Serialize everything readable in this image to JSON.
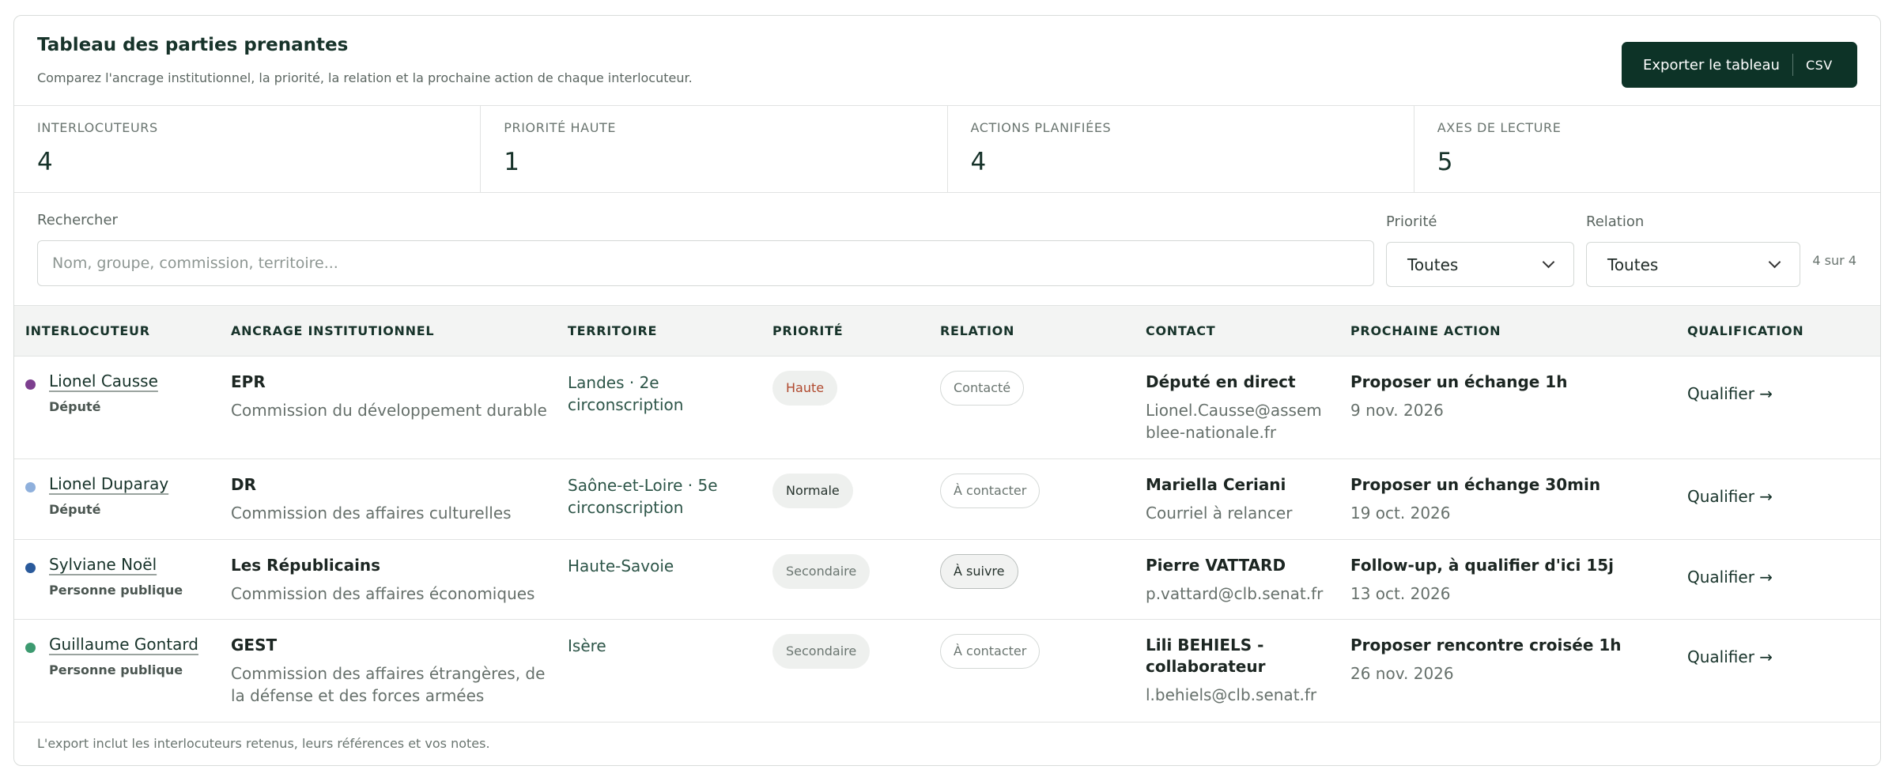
{
  "header": {
    "title": "Tableau des parties prenantes",
    "subtitle": "Comparez l'ancrage institutionnel, la priorité, la relation et la prochaine action de chaque interlocuteur.",
    "export_label": "Exporter le tableau",
    "export_format": "CSV"
  },
  "stats": [
    {
      "label": "INTERLOCUTEURS",
      "value": "4"
    },
    {
      "label": "PRIORITÉ HAUTE",
      "value": "1"
    },
    {
      "label": "ACTIONS PLANIFIÉES",
      "value": "4"
    },
    {
      "label": "AXES DE LECTURE",
      "value": "5"
    }
  ],
  "filters": {
    "search_label": "Rechercher",
    "search_placeholder": "Nom, groupe, commission, territoire...",
    "priority_label": "Priorité",
    "priority_value": "Toutes",
    "relation_label": "Relation",
    "relation_value": "Toutes",
    "count": "4 sur 4"
  },
  "table": {
    "columns": [
      "INTERLOCUTEUR",
      "ANCRAGE INSTITUTIONNEL",
      "TERRITOIRE",
      "PRIORITÉ",
      "RELATION",
      "CONTACT",
      "PROCHAINE ACTION",
      "QUALIFICATION"
    ],
    "rows": [
      {
        "name": "Lionel Causse",
        "role": "Député",
        "dot_color": "#7d3f8f",
        "group": "EPR",
        "commission": "Commission du développement durable",
        "territory": "Landes · 2e circonscription",
        "priority": "Haute",
        "relation": "Contacté",
        "contact_name": "Député en direct",
        "contact_detail": "Lionel.Causse@assemblee-nationale.fr",
        "action": "Proposer un échange 1h",
        "action_date": "9 nov. 2026",
        "qualify": "Qualifier →"
      },
      {
        "name": "Lionel Duparay",
        "role": "Député",
        "dot_color": "#8fb0dc",
        "group": "DR",
        "commission": "Commission des affaires culturelles",
        "territory": "Saône-et-Loire · 5e circonscription",
        "priority": "Normale",
        "relation": "À contacter",
        "contact_name": "Mariella Ceriani",
        "contact_detail": "Courriel à relancer",
        "action": "Proposer un échange 30min",
        "action_date": "19 oct. 2026",
        "qualify": "Qualifier →"
      },
      {
        "name": "Sylviane Noël",
        "role": "Personne publique",
        "dot_color": "#2a5a9b",
        "group": "Les Républicains",
        "commission": "Commission des affaires économiques",
        "territory": "Haute-Savoie",
        "priority": "Secondaire",
        "relation": "À suivre",
        "contact_name": "Pierre VATTARD",
        "contact_detail": "p.vattard@clb.senat.fr",
        "action": "Follow-up, à qualifier d'ici 15j",
        "action_date": "13 oct. 2026",
        "qualify": "Qualifier →"
      },
      {
        "name": "Guillaume Gontard",
        "role": "Personne publique",
        "dot_color": "#3d9a70",
        "group": "GEST",
        "commission": "Commission des affaires étrangères, de la défense et des forces armées",
        "territory": "Isère",
        "priority": "Secondaire",
        "relation": "À contacter",
        "contact_name": "Lili BEHIELS - collaborateur",
        "contact_detail": "l.behiels@clb.senat.fr",
        "action": "Proposer rencontre croisée 1h",
        "action_date": "26 nov. 2026",
        "qualify": "Qualifier →"
      }
    ]
  },
  "footer": {
    "note": "L'export inclut les interlocuteurs retenus, leurs références et vos notes."
  }
}
